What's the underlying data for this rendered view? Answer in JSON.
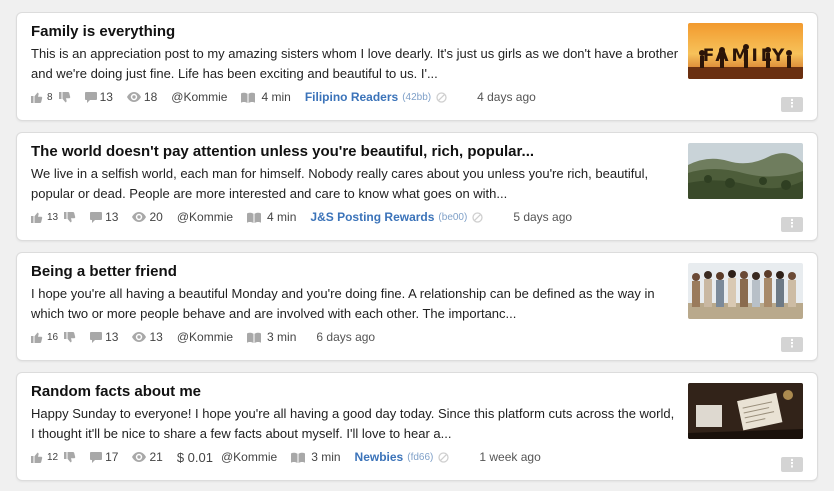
{
  "posts": [
    {
      "title": "Family is everything",
      "excerpt": "This is an appreciation post to my amazing sisters whom I love dearly. It's just us girls as we don't have a brother and we're doing just fine. Life has been exciting and beautiful to us. I'...",
      "upvotes": "8",
      "comments": "13",
      "views": "18",
      "payout": "",
      "author": "@Kommie",
      "read_time": "4 min",
      "community": "Filipino Readers",
      "community_code": "(42bb)",
      "date": "4 days ago",
      "thumbnail_text": "FAMILY"
    },
    {
      "title": "The world doesn't pay attention unless you're beautiful, rich, popular...",
      "excerpt": "We live in a selfish world, each man for himself. Nobody really cares about you unless you're rich, beautiful, popular or dead. People are more interested and care to know what goes on with...",
      "upvotes": "13",
      "comments": "13",
      "views": "20",
      "payout": "",
      "author": "@Kommie",
      "read_time": "4 min",
      "community": "J&S Posting Rewards",
      "community_code": "(be00)",
      "date": "5 days ago"
    },
    {
      "title": "Being a better friend",
      "excerpt": "I hope you're all having a beautiful Monday and you're doing fine. A relationship can be defined as the way in which two or more people behave and are involved with each other. The importanc...",
      "upvotes": "16",
      "comments": "13",
      "views": "13",
      "payout": "",
      "author": "@Kommie",
      "read_time": "3 min",
      "community": "",
      "community_code": "",
      "date": "6 days ago"
    },
    {
      "title": "Random facts about me",
      "excerpt": "Happy Sunday to everyone! I hope you're all having a good day today. Since this platform cuts across the world, I thought it'll be nice to share a few facts about myself. I'll love to hear a...",
      "upvotes": "12",
      "comments": "17",
      "views": "21",
      "payout": "$ 0.01",
      "author": "@Kommie",
      "read_time": "3 min",
      "community": "Newbies",
      "community_code": "(fd66)",
      "date": "1 week ago"
    }
  ],
  "colors": {
    "community_link": "#3b73b9",
    "icon_gray": "#a8a8a8",
    "card_border": "#dcdcdc"
  },
  "icons": [
    "thumbs-up-icon",
    "thumbs-down-icon",
    "comment-icon",
    "eye-icon",
    "book-icon",
    "blocked-icon",
    "more-icon"
  ]
}
